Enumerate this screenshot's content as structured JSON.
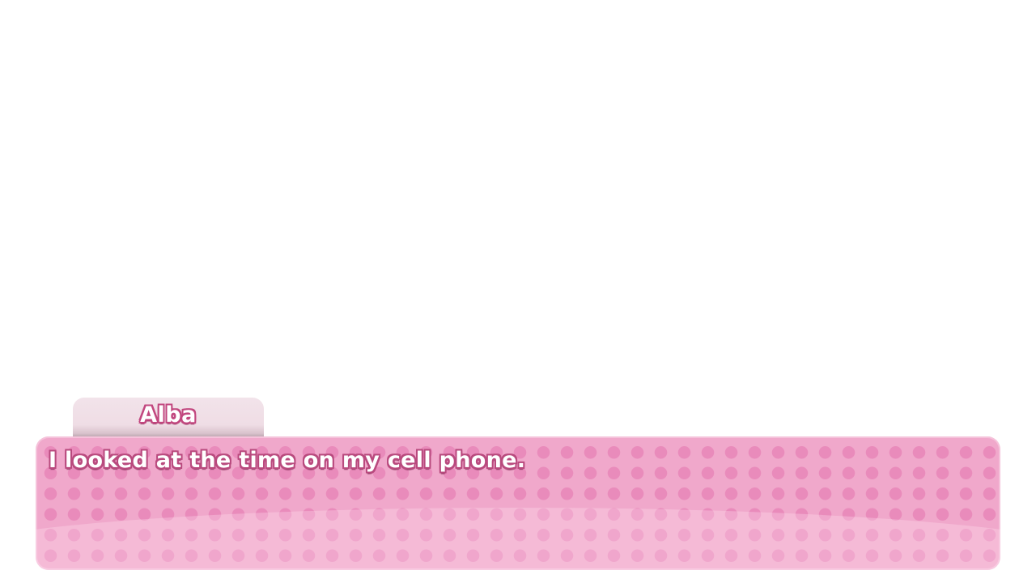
{
  "dialogue": {
    "speaker": "Alba",
    "text": "I looked at the time on my cell phone."
  },
  "colors": {
    "textbox_pink": "#f0a8cb",
    "dot_pink": "#e98bbb",
    "name_tab": "#f2e3ea",
    "text_outline": "#c2477f"
  }
}
